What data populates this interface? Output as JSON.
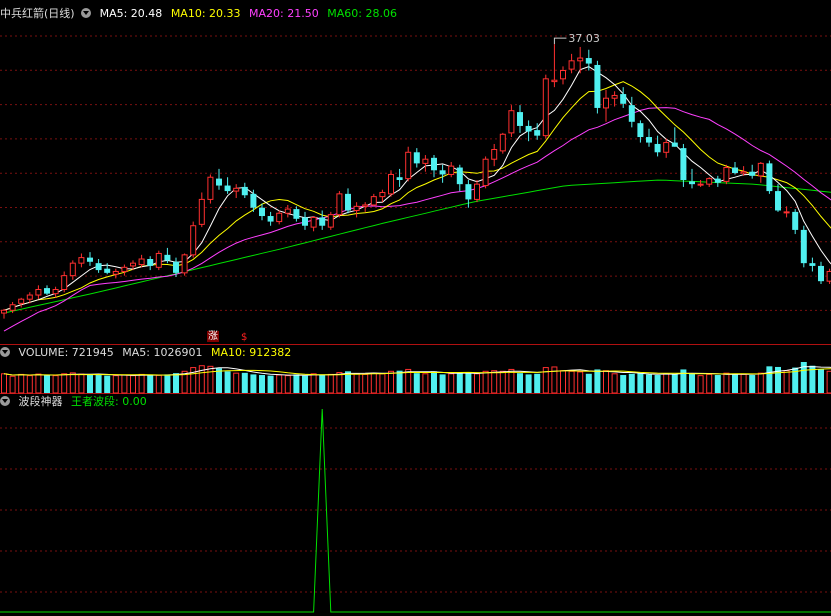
{
  "stock_title": "中兵红箭(日线)",
  "price_panel": {
    "indicators": [
      {
        "label": "MA5: 20.48",
        "color": "#ffffff"
      },
      {
        "label": "MA10: 20.33",
        "color": "#ffff00"
      },
      {
        "label": "MA20: 21.50",
        "color": "#ff40ff"
      },
      {
        "label": "MA60: 28.06",
        "color": "#00e000"
      }
    ],
    "peak_label": "37.03",
    "marks": [
      "涨",
      "$"
    ]
  },
  "volume_panel": {
    "indicators": [
      {
        "label": "VOLUME: 721945",
        "color": "#dddddd"
      },
      {
        "label": "MA5: 1026901",
        "color": "#dddddd"
      },
      {
        "label": "MA10: 912382",
        "color": "#ffff00"
      }
    ]
  },
  "wave_panel": {
    "name": "波段神器",
    "indicator": {
      "label": "王者波段: 0.00",
      "color": "#00e000"
    }
  },
  "colors": {
    "up": "#ff3030",
    "down": "#50f0f0",
    "grid": "#7a1010",
    "divider": "#b01010"
  },
  "chart_data": {
    "type": "candlestick",
    "price_range": [
      15.8,
      38.6
    ],
    "candles": [
      [
        17.6,
        17.9,
        17.2,
        17.8
      ],
      [
        17.8,
        18.4,
        17.6,
        18.2
      ],
      [
        18.3,
        18.7,
        18.0,
        18.6
      ],
      [
        18.6,
        19.1,
        18.3,
        18.9
      ],
      [
        18.9,
        19.6,
        18.6,
        19.3
      ],
      [
        19.4,
        19.6,
        18.9,
        19.0
      ],
      [
        19.0,
        19.5,
        18.7,
        19.3
      ],
      [
        19.3,
        20.6,
        19.1,
        20.3
      ],
      [
        20.3,
        21.4,
        20.0,
        21.2
      ],
      [
        21.2,
        21.9,
        20.9,
        21.6
      ],
      [
        21.6,
        22.0,
        21.0,
        21.3
      ],
      [
        21.2,
        21.5,
        20.5,
        20.7
      ],
      [
        20.8,
        21.2,
        20.4,
        20.5
      ],
      [
        20.4,
        20.8,
        20.1,
        20.6
      ],
      [
        20.6,
        21.1,
        20.3,
        20.9
      ],
      [
        21.0,
        21.4,
        20.7,
        21.2
      ],
      [
        21.1,
        21.8,
        20.9,
        21.5
      ],
      [
        21.5,
        21.7,
        20.7,
        21.0
      ],
      [
        20.9,
        22.1,
        20.7,
        21.9
      ],
      [
        21.8,
        22.3,
        21.2,
        21.4
      ],
      [
        21.3,
        21.6,
        20.2,
        20.5
      ],
      [
        20.5,
        21.9,
        20.3,
        21.8
      ],
      [
        21.8,
        24.2,
        21.6,
        23.9
      ],
      [
        24.0,
        26.3,
        23.8,
        25.8
      ],
      [
        25.8,
        27.6,
        25.5,
        27.4
      ],
      [
        27.3,
        28.0,
        26.5,
        26.8
      ],
      [
        26.8,
        27.4,
        26.2,
        26.4
      ],
      [
        26.4,
        26.9,
        25.9,
        26.6
      ],
      [
        26.7,
        27.0,
        25.9,
        26.1
      ],
      [
        26.2,
        26.5,
        24.9,
        25.2
      ],
      [
        25.2,
        25.5,
        24.3,
        24.6
      ],
      [
        24.6,
        24.9,
        23.9,
        24.2
      ],
      [
        24.2,
        25.0,
        24.0,
        24.8
      ],
      [
        24.8,
        25.4,
        24.5,
        25.1
      ],
      [
        25.1,
        25.3,
        24.2,
        24.4
      ],
      [
        24.5,
        24.9,
        23.6,
        23.9
      ],
      [
        23.8,
        24.6,
        23.5,
        24.5
      ],
      [
        24.5,
        25.0,
        23.6,
        23.9
      ],
      [
        23.8,
        24.9,
        23.6,
        24.7
      ],
      [
        24.7,
        26.4,
        24.5,
        26.2
      ],
      [
        26.2,
        26.6,
        24.8,
        25.0
      ],
      [
        25.0,
        25.6,
        24.5,
        25.3
      ],
      [
        25.3,
        25.6,
        24.9,
        25.4
      ],
      [
        25.4,
        26.2,
        25.3,
        26.0
      ],
      [
        26.0,
        26.5,
        25.6,
        26.3
      ],
      [
        26.2,
        27.9,
        26.0,
        27.6
      ],
      [
        27.4,
        28.0,
        26.7,
        27.2
      ],
      [
        27.3,
        29.6,
        27.1,
        29.2
      ],
      [
        29.2,
        29.5,
        28.1,
        28.4
      ],
      [
        28.4,
        29.0,
        27.8,
        28.7
      ],
      [
        28.8,
        29.0,
        27.4,
        27.9
      ],
      [
        27.9,
        28.3,
        27.0,
        27.6
      ],
      [
        27.6,
        28.5,
        27.4,
        28.2
      ],
      [
        28.1,
        28.3,
        26.4,
        26.9
      ],
      [
        26.9,
        27.2,
        25.2,
        25.8
      ],
      [
        25.8,
        27.2,
        25.6,
        26.9
      ],
      [
        26.8,
        28.9,
        26.6,
        28.7
      ],
      [
        28.7,
        29.8,
        28.2,
        29.4
      ],
      [
        29.3,
        30.6,
        29.1,
        30.5
      ],
      [
        30.6,
        32.6,
        30.3,
        32.2
      ],
      [
        32.1,
        32.6,
        30.6,
        31.1
      ],
      [
        31.1,
        31.5,
        30.0,
        30.7
      ],
      [
        30.8,
        31.3,
        30.1,
        30.4
      ],
      [
        30.4,
        34.8,
        30.2,
        34.5
      ],
      [
        34.3,
        37.0,
        33.9,
        34.4
      ],
      [
        34.5,
        35.4,
        34.1,
        35.1
      ],
      [
        35.2,
        36.3,
        34.9,
        35.8
      ],
      [
        35.8,
        36.8,
        34.9,
        36.0
      ],
      [
        36.0,
        36.6,
        35.1,
        35.6
      ],
      [
        35.5,
        35.8,
        32.0,
        32.4
      ],
      [
        32.4,
        33.7,
        31.4,
        33.1
      ],
      [
        33.1,
        33.6,
        32.5,
        33.3
      ],
      [
        33.4,
        33.9,
        32.4,
        32.7
      ],
      [
        32.6,
        33.2,
        31.0,
        31.4
      ],
      [
        31.3,
        31.5,
        29.9,
        30.3
      ],
      [
        30.3,
        30.9,
        29.6,
        29.9
      ],
      [
        29.8,
        30.4,
        28.9,
        29.2
      ],
      [
        29.2,
        30.2,
        28.8,
        29.9
      ],
      [
        29.9,
        31.0,
        29.6,
        29.6
      ],
      [
        29.5,
        29.8,
        26.7,
        27.2
      ],
      [
        27.1,
        28.0,
        26.6,
        26.9
      ],
      [
        26.9,
        27.2,
        26.7,
        26.9
      ],
      [
        26.9,
        27.4,
        26.7,
        27.3
      ],
      [
        27.3,
        27.5,
        26.7,
        27.0
      ],
      [
        27.1,
        28.3,
        26.9,
        28.1
      ],
      [
        28.1,
        28.5,
        27.6,
        27.7
      ],
      [
        27.7,
        28.2,
        27.5,
        27.8
      ],
      [
        27.8,
        28.3,
        27.3,
        27.5
      ],
      [
        27.5,
        28.5,
        27.0,
        28.4
      ],
      [
        28.4,
        28.6,
        26.2,
        26.4
      ],
      [
        26.4,
        26.9,
        24.9,
        25.0
      ],
      [
        24.9,
        25.3,
        24.5,
        24.9
      ],
      [
        24.9,
        25.1,
        23.3,
        23.6
      ],
      [
        23.6,
        23.9,
        20.9,
        21.2
      ],
      [
        21.2,
        21.6,
        20.6,
        21.0
      ],
      [
        21.0,
        21.3,
        19.7,
        19.9
      ],
      [
        19.9,
        20.8,
        19.7,
        20.6
      ],
      [
        20.6,
        20.9,
        20.3,
        20.4
      ],
      [
        20.4,
        20.9,
        20.3,
        20.8
      ]
    ],
    "volume": [
      620,
      540,
      600,
      560,
      610,
      580,
      560,
      620,
      650,
      610,
      600,
      580,
      560,
      560,
      580,
      560,
      600,
      580,
      570,
      600,
      640,
      700,
      820,
      880,
      860,
      800,
      700,
      640,
      650,
      600,
      580,
      560,
      580,
      560,
      600,
      560,
      620,
      580,
      600,
      660,
      700,
      620,
      600,
      640,
      620,
      700,
      720,
      760,
      640,
      620,
      700,
      600,
      620,
      640,
      660,
      620,
      700,
      720,
      700,
      760,
      640,
      600,
      620,
      820,
      840,
      720,
      700,
      680,
      620,
      760,
      720,
      620,
      580,
      620,
      640,
      600,
      580,
      620,
      600,
      760,
      620,
      560,
      600,
      580,
      640,
      620,
      600,
      580,
      640,
      860,
      840,
      720,
      820,
      1000,
      880,
      760,
      700,
      620,
      722
    ],
    "wave_indicator": {
      "peak_index": 37,
      "peak_value": 100,
      "baseline": 0
    }
  }
}
